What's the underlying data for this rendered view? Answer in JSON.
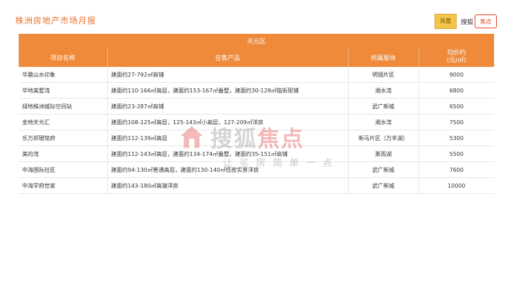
{
  "header": {
    "title": "株洲房地产市场月报",
    "logo_left_text": "凤凰网",
    "logo_right_text": "搜狐焦点"
  },
  "table": {
    "district": "天元区",
    "columns": [
      "项目名称",
      "在售产品",
      "所属版块",
      "均价约\n(元/㎡)"
    ],
    "rows": [
      [
        "华晨山水印象",
        "建面约27-792㎡商铺",
        "明镜片区",
        "9000"
      ],
      [
        "华地美墅湾",
        "建面约110-166㎡高层，建面约153-167㎡叠墅，建面约30-128㎡临街现铺",
        "湘水湾",
        "6800"
      ],
      [
        "绿地株洲城际空间站",
        "建面约23-287㎡商铺",
        "武广新城",
        "6500"
      ],
      [
        "金地天元汇",
        "建面约108-125㎡高层，125-143㎡小高层，127-209㎡洋房",
        "湘水湾",
        "7500"
      ],
      [
        "乐万邦珺铭府",
        "建面约112-139㎡高层",
        "新马片区（万丰湖）",
        "5300"
      ],
      [
        "美的湾",
        "建面约112-143㎡高层，建面约134-174㎡叠墅，建面约35-151㎡商铺",
        "栗雨湖",
        "5500"
      ],
      [
        "中海国际社区",
        "建面约94-130㎡普通高层，建面约130-140㎡低密实景洋房",
        "武广新城",
        "7600"
      ],
      [
        "中海学府世家",
        "建面约143-180㎡高端洋房",
        "武广新城",
        "10000"
      ]
    ]
  },
  "watermark": {
    "brand_a": "搜狐",
    "brand_b": "焦点",
    "slogan": "让买房简单一点"
  }
}
